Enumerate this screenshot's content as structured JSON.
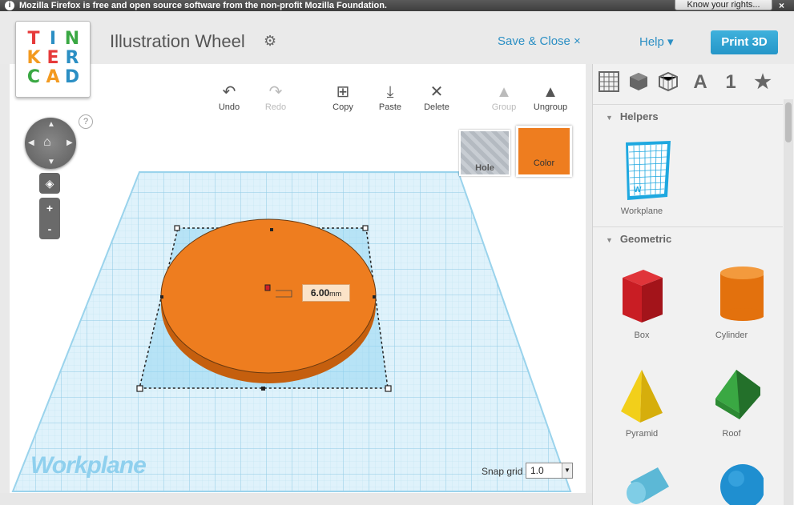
{
  "browser": {
    "notification": "Mozilla Firefox is free and open source software from the non-profit Mozilla Foundation.",
    "rights_button": "Know your rights...",
    "close": "×"
  },
  "header": {
    "logo_letters": [
      "T",
      "I",
      "N",
      "K",
      "E",
      "R",
      "C",
      "A",
      "D"
    ],
    "logo_colors": [
      "#e63a3a",
      "#2b8fc4",
      "#3aa843",
      "#f39a1f",
      "#e63a3a",
      "#2b8fc4",
      "#3aa843",
      "#f39a1f",
      "#2b8fc4"
    ],
    "title": "Illustration Wheel",
    "save_close": "Save & Close ×",
    "help": "Help ▾",
    "print3d": "Print 3D"
  },
  "toolbar": {
    "undo": "Undo",
    "redo": "Redo",
    "copy": "Copy",
    "paste": "Paste",
    "delete": "Delete",
    "group": "Group",
    "ungroup": "Ungroup"
  },
  "inspector": {
    "hole": "Hole",
    "color": "Color",
    "color_value": "#ee7d1f"
  },
  "navigation": {
    "help": "?",
    "zoom_in": "+",
    "zoom_out": "-"
  },
  "workspace": {
    "dimension_value": "6.00",
    "dimension_unit": "mm",
    "workplane_label": "Workplane",
    "snap_grid_label": "Snap grid",
    "snap_grid_value": "1.0"
  },
  "sidebar": {
    "tabs": [
      "grid-icon",
      "cube-icon",
      "wireframe-cube-icon",
      "A",
      "1",
      "★"
    ],
    "helpers": {
      "title": "Helpers",
      "items": [
        {
          "label": "Workplane",
          "icon": "workplane-icon"
        }
      ]
    },
    "geometric": {
      "title": "Geometric",
      "items": [
        {
          "label": "Box",
          "color": "#d32027"
        },
        {
          "label": "Cylinder",
          "color": "#ef7d14"
        },
        {
          "label": "Pyramid",
          "color": "#f2cf1a"
        },
        {
          "label": "Roof",
          "color": "#3aa843"
        }
      ]
    }
  }
}
